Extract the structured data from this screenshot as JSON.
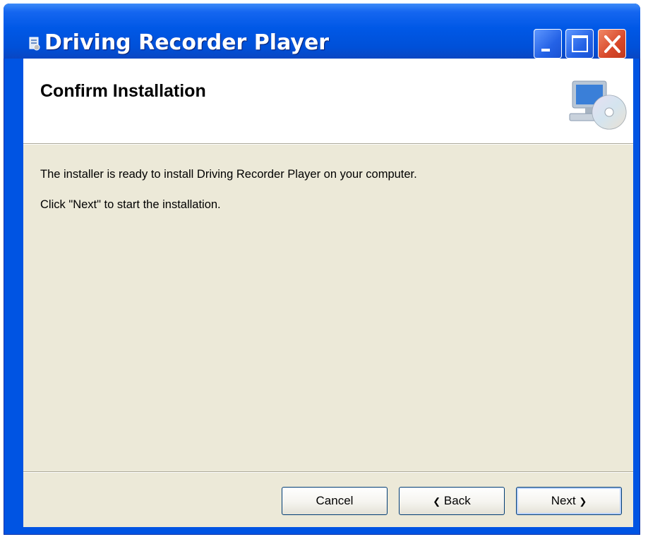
{
  "window": {
    "title": "Driving Recorder Player"
  },
  "titlebar_buttons": {
    "minimize_icon": "minimize-icon",
    "maximize_icon": "maximize-icon",
    "close_icon": "close-icon"
  },
  "header": {
    "title": "Confirm Installation",
    "icon": "computer-cd-icon"
  },
  "body": {
    "line1": "The installer is ready to install Driving Recorder Player on your computer.",
    "line2": "Click \"Next\" to start the installation."
  },
  "buttons": {
    "cancel": "Cancel",
    "back": "Back",
    "next": "Next"
  },
  "colors": {
    "titlebar": "#0058e6",
    "dialog_bg": "#ece9d8",
    "close_button": "#d8482a"
  }
}
